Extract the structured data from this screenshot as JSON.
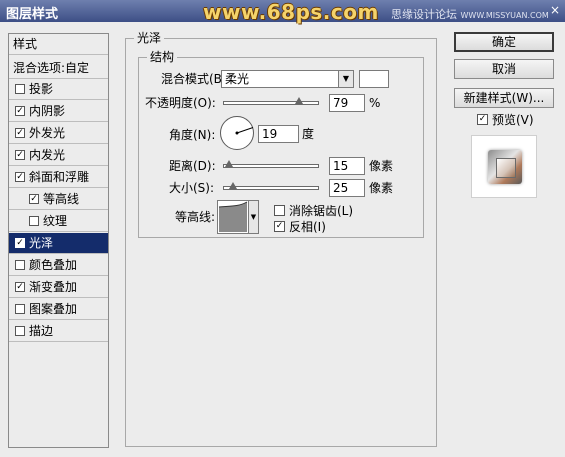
{
  "window": {
    "title": "图层样式",
    "watermark_main": "www.68ps.com",
    "watermark_side": "思缘设计论坛",
    "watermark_side_url": "WWW.MISSYUAN.COM",
    "close_symbol": "×"
  },
  "styles_list": {
    "header": "样式",
    "blend_options": "混合选项:自定",
    "items": [
      {
        "label": "投影",
        "checked": false,
        "check": "",
        "selected": false
      },
      {
        "label": "内阴影",
        "checked": true,
        "check": "✓",
        "selected": false
      },
      {
        "label": "外发光",
        "checked": true,
        "check": "✓",
        "selected": false
      },
      {
        "label": "内发光",
        "checked": true,
        "check": "✓",
        "selected": false
      },
      {
        "label": "斜面和浮雕",
        "checked": true,
        "check": "✓",
        "selected": false
      },
      {
        "label": "等高线",
        "checked": true,
        "check": "✓",
        "selected": false,
        "indent": true
      },
      {
        "label": "纹理",
        "checked": false,
        "check": "",
        "selected": false,
        "indent": true
      },
      {
        "label": "光泽",
        "checked": true,
        "check": "✓",
        "selected": true
      },
      {
        "label": "颜色叠加",
        "checked": false,
        "check": "",
        "selected": false
      },
      {
        "label": "渐变叠加",
        "checked": true,
        "check": "✓",
        "selected": false
      },
      {
        "label": "图案叠加",
        "checked": false,
        "check": "",
        "selected": false
      },
      {
        "label": "描边",
        "checked": false,
        "check": "",
        "selected": false
      }
    ]
  },
  "panel": {
    "group_title": "光泽",
    "structure_title": "结构",
    "blend_mode_label": "混合模式(B):",
    "blend_mode_value": "柔光",
    "blend_color": "#ffffff",
    "opacity_label": "不透明度(O):",
    "opacity_value": "79",
    "opacity_unit": "%",
    "opacity_fraction": 0.79,
    "angle_label": "角度(N):",
    "angle_value": "19",
    "angle_unit": "度",
    "distance_label": "距离(D):",
    "distance_value": "15",
    "distance_unit": "像素",
    "distance_fraction": 0.06,
    "size_label": "大小(S):",
    "size_value": "25",
    "size_unit": "像素",
    "size_fraction": 0.1,
    "contour_label": "等高线:",
    "anti_alias_label": "消除锯齿(L)",
    "anti_alias_checked": false,
    "anti_alias_check": "",
    "invert_label": "反相(I)",
    "invert_checked": true,
    "invert_check": "✓"
  },
  "buttons": {
    "ok": "确定",
    "cancel": "取消",
    "new_style": "新建样式(W)...",
    "preview_label": "预览(V)",
    "preview_checked": true,
    "preview_check": "✓"
  }
}
